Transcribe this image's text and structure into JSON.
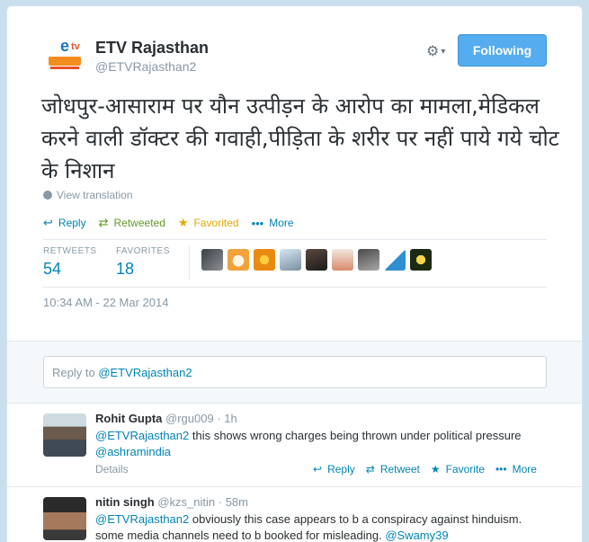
{
  "account": {
    "name": "ETV Rajasthan",
    "handle": "@ETVRajasthan2",
    "follow_label": "Following"
  },
  "tweet": {
    "text": "जोधपुर-आसाराम पर यौन उत्पीड़न के आरोप का मामला,मेडिकल करने वाली डॉक्टर की गवाही,पीड़िता के शरीर पर नहीं पाये गये चोट के निशान",
    "view_translation": "View translation",
    "actions": {
      "reply": "Reply",
      "retweeted": "Retweeted",
      "favorited": "Favorited",
      "more": "More"
    },
    "stats": {
      "retweets_label": "RETWEETS",
      "retweets": "54",
      "favorites_label": "FAVORITES",
      "favorites": "18"
    },
    "timestamp": "10:34 AM - 22 Mar 2014"
  },
  "reply_box": {
    "placeholder_prefix": "Reply to ",
    "placeholder_handle": "@ETVRajasthan2"
  },
  "replies": [
    {
      "name": "Rohit Gupta",
      "handle": "@rgu009",
      "time": "· 1h",
      "mention": "@ETVRajasthan2",
      "text": " this shows wrong charges being thrown under political pressure ",
      "tail_link": "@ashramindia",
      "details": "Details",
      "actions": {
        "reply": "Reply",
        "retweet": "Retweet",
        "favorite": "Favorite",
        "more": "More"
      }
    },
    {
      "name": "nitin singh",
      "handle": "@kzs_nitin",
      "time": "· 58m",
      "mention": "@ETVRajasthan2",
      "text": " obviously this case appears to b a conspiracy against hinduism. some media channels need to b booked for misleading. ",
      "tail_link": "@Swamy39"
    }
  ],
  "colors": {
    "accent": "#55acee",
    "link": "#0084b4",
    "retweet": "#609928",
    "favorite": "#e6a600",
    "muted": "#8899a6"
  }
}
